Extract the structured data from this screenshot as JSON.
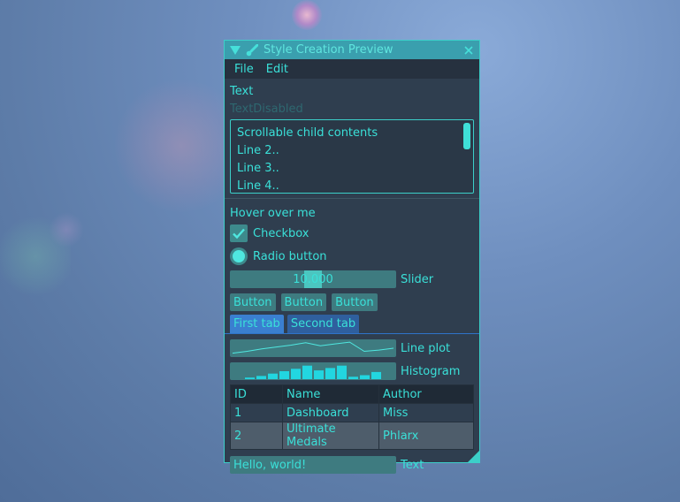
{
  "window": {
    "title": "Style Creation Preview",
    "accent_color": "#3ae0d8",
    "title_bar_color": "#3a9fae",
    "background_color": "#2f3e4f"
  },
  "menu": [
    "File",
    "Edit"
  ],
  "labels": {
    "text": "Text",
    "text_disabled": "TextDisabled"
  },
  "scroll_child": {
    "lines": [
      "Scrollable child contents",
      "Line 2..",
      "Line 3..",
      "Line 4.."
    ]
  },
  "hover_label": "Hover over me",
  "checkbox": {
    "label": "Checkbox",
    "checked": true
  },
  "radio": {
    "label": "Radio button",
    "selected": true
  },
  "slider": {
    "value": "10.000",
    "label": "Slider",
    "fraction": 0.5
  },
  "buttons": [
    "Button",
    "Button",
    "Button"
  ],
  "tabs": [
    {
      "label": "First tab",
      "active": true
    },
    {
      "label": "Second tab",
      "active": false
    }
  ],
  "line_plot": {
    "label": "Line plot",
    "values": [
      0.1,
      0.25,
      0.45,
      0.6,
      0.75,
      0.95,
      0.7,
      0.85,
      0.99,
      0.25,
      0.35,
      0.5
    ]
  },
  "histogram": {
    "label": "Histogram",
    "values": [
      0.1,
      0.2,
      0.35,
      0.5,
      0.65,
      0.85,
      0.55,
      0.7,
      0.85,
      0.15,
      0.25,
      0.45
    ]
  },
  "table": {
    "columns": [
      "ID",
      "Name",
      "Author"
    ],
    "rows": [
      [
        "1",
        "Dashboard",
        "Miss"
      ],
      [
        "2",
        "Ultimate Medals",
        "Phlarx"
      ]
    ]
  },
  "input": {
    "value": "Hello, world!",
    "label": "Text"
  }
}
